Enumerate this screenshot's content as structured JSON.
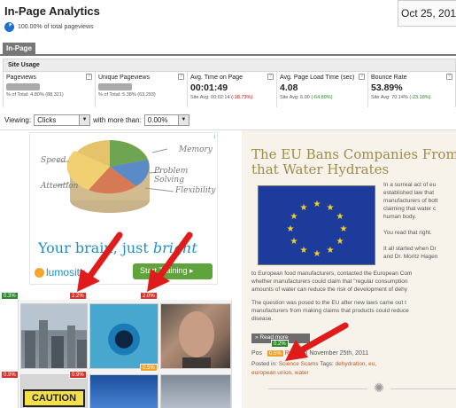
{
  "header": {
    "title": "In-Page Analytics",
    "pageviews_note": "100.00% of total pageviews",
    "date": "Oct 25, 201"
  },
  "tabs": [
    {
      "label": "In-Page"
    }
  ],
  "site_usage": {
    "label": "Site Usage"
  },
  "metrics": [
    {
      "label": "Pageviews",
      "value": "",
      "sub_prefix": "% of Total: 4.80% (88,321)",
      "sub_delta": "",
      "delta_type": ""
    },
    {
      "label": "Unique Pageviews",
      "value": "",
      "sub_prefix": "% of Total: 5.38% (63,293)",
      "sub_delta": "",
      "delta_type": ""
    },
    {
      "label": "Avg. Time on Page",
      "value": "00:01:49",
      "sub_prefix": "Site Avg: 00:02:14 ",
      "sub_delta": "(-18.73%)",
      "delta_type": "neg"
    },
    {
      "label": "Avg. Page Load Time (sec)",
      "value": "4.08",
      "sub_prefix": "Site Avg: 6.00 ",
      "sub_delta": "(-64.89%)",
      "delta_type": "pos"
    },
    {
      "label": "Bounce Rate",
      "value": "53.89%",
      "sub_prefix": "Site Avg: 70.14% ",
      "sub_delta": "(-23.18%)",
      "delta_type": "pos"
    }
  ],
  "viewing": {
    "label": "Viewing:",
    "selected": "Clicks",
    "more_than_label": "with more than:",
    "threshold": "0.00%"
  },
  "ad": {
    "words": [
      "Memory",
      "Speed",
      "Problem Solving",
      "Attention",
      "Flexibility"
    ],
    "headline_a": "Your brain, just ",
    "headline_b": "bright",
    "brand": "lumosity",
    "cta": "Start Training ▸",
    "info": "i"
  },
  "badges": [
    "0.3%",
    "2.2%",
    "2.0%",
    "0.9%",
    "0.9%",
    "0.5%",
    "0.2%",
    "0.5%"
  ],
  "thumb_caption": "CAUTION",
  "blog": {
    "title_line1": "The EU Bans Companies From Cla",
    "title_line2": "that Water Hydrates",
    "side_lines": [
      "In a surreal act of eu",
      "established law that",
      "manufacturers of bott",
      "claiming that water c",
      "human body.",
      "",
      "You read that right.",
      "",
      "It all started when Dr",
      "and Dr. Moritz Hagen"
    ],
    "para1_lines": [
      "to European food manufacturers, contacted the European Com",
      "whether manufacturers could claim that \"regular consumption",
      "amounts of water can reduce the risk of development of dehy"
    ],
    "para2_lines": [
      "The question was posed to the EU after new laws came out t",
      "manufacturers from making claims that products could reduce",
      "disease."
    ],
    "read_more": "» Read more",
    "post_prefix": "Pos",
    "post_by": "by ",
    "author": "Ryan",
    "post_date": " on November 25th, 2011",
    "posted_in_label": "Posted in: ",
    "category": "Science Scams",
    "tags_label": "  Tags: ",
    "tags_line1": "dehydration, eu,",
    "tags_line2": "european union, water"
  }
}
